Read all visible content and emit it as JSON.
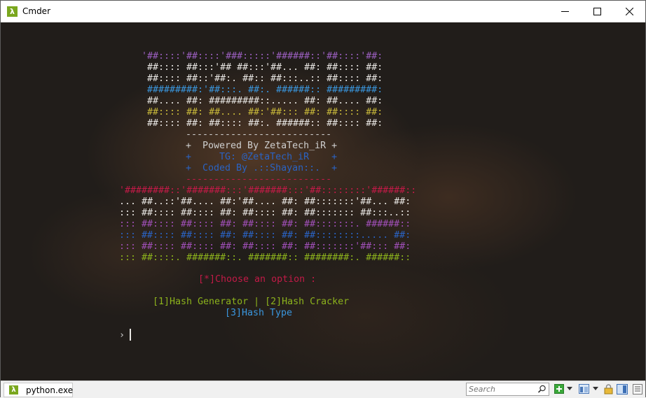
{
  "window": {
    "title": "Cmder",
    "app_icon_glyph": "λ"
  },
  "terminal": {
    "banner1": [
      {
        "text": "'##::::'##::::'###:::::'######::'##::::'##:",
        "color": "#9b5fc0"
      },
      {
        "text": " ##:::: ##:::'## ##:::'##... ##: ##:::: ##:",
        "color": "#e8e6e3"
      },
      {
        "text": " ##:::: ##::'##:. ##:: ##:::..:: ##:::: ##:",
        "color": "#e8e6e3"
      },
      {
        "text": " #########:'##:::. ##:. ######:: #########:",
        "color": "#3a96dd"
      },
      {
        "text": " ##.... ##: #########::..... ##: ##.... ##:",
        "color": "#e8e6e3"
      },
      {
        "text": " ##:::: ##: ##.... ##:'##::: ##: ##:::: ##:",
        "color": "#c9b93a"
      },
      {
        "text": " ##:::: ##: ##:::: ##:. ######:: ##:::: ##:",
        "color": "#e8e6e3"
      }
    ],
    "separator_top": "--------------------------",
    "powered_by": "+  Powered By ZetaTech_iR +",
    "tg_line": "+     TG: @ZetaTech_iR    +",
    "coded_by": "+  Coded By .::Shayan::.  +",
    "separator_bottom": "--------------------------",
    "banner2": [
      {
        "text": "'########::'#######:::'#######:::'##::::::::'######::",
        "color": "#c21a47"
      },
      {
        "text": "... ##..::'##.... ##:'##.... ##: ##:::::::'##... ##:",
        "color": "#e8e6e3"
      },
      {
        "text": "::: ##:::: ##:::: ##: ##:::: ##: ##::::::: ##:::..::",
        "color": "#e8e6e3"
      },
      {
        "text": "::: ##:::: ##:::: ##: ##:::: ##: ##:::::::. ######::",
        "color": "#a04fb8"
      },
      {
        "text": "::: ##:::: ##:::: ##: ##:::: ##: ##::::::::..... ##:",
        "color": "#2a63c4"
      },
      {
        "text": "::: ##:::: ##:::: ##: ##:::: ##: ##:::::::'##::: ##:",
        "color": "#a04fb8"
      },
      {
        "text": "::: ##::::. #######::. #######:: ########:. ######::",
        "color": "#8cb21c"
      }
    ],
    "choose_option": "[*]Choose an option :",
    "options_line": "[1]Hash Generator | [2]Hash Cracker",
    "option3": "[3]Hash Type",
    "prompt_symbol": "›"
  },
  "statusbar": {
    "tab_label": "python.exe",
    "search_placeholder": "Search",
    "icons": [
      "add-console-icon",
      "dropdown-arrow-icon",
      "layout-icon",
      "dropdown-arrow-icon",
      "lock-icon",
      "split-view-icon",
      "menu-icon"
    ]
  },
  "colors": {
    "accent_green": "#7aa71e",
    "terminal_bg": "#211d1a"
  }
}
